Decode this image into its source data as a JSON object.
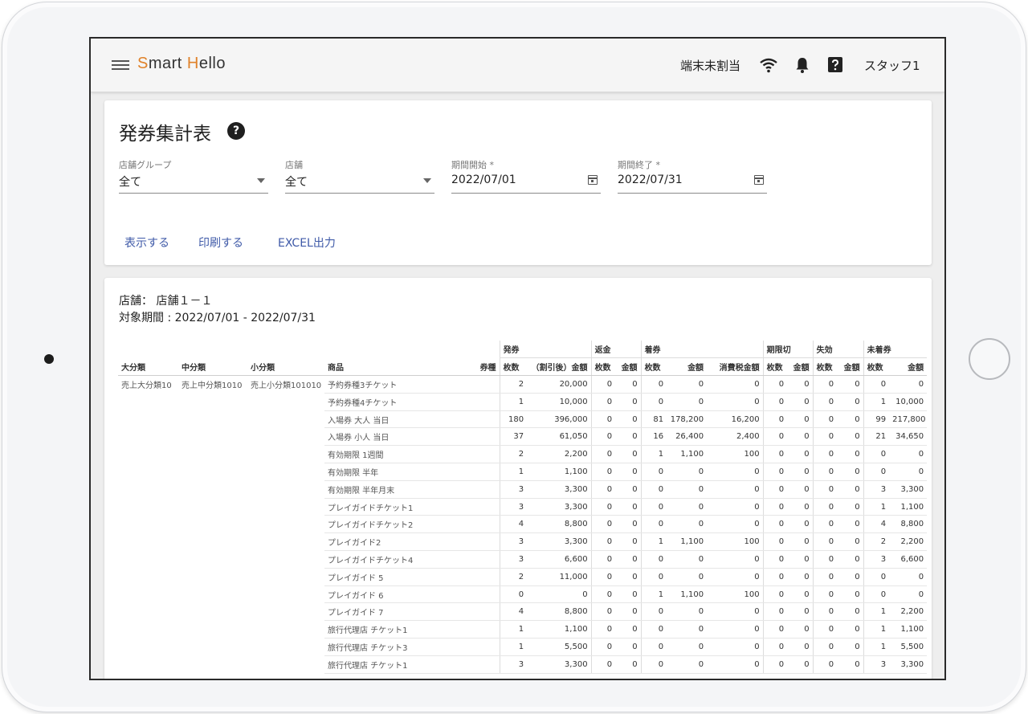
{
  "app": {
    "logo_first": "S",
    "logo_mid": "mart ",
    "logo_accent": "H",
    "logo_rest": "ello",
    "terminal": "端末未割当",
    "user": "スタッフ1",
    "accent_color": "#e0822a"
  },
  "icons": [
    "menu-icon",
    "wifi-icon",
    "bell-icon",
    "help-icon",
    "calendar-icon",
    "dropdown-icon"
  ],
  "page": {
    "title": "発券集計表",
    "filters": {
      "store_group": {
        "label": "店舗グループ",
        "value": "全て"
      },
      "store": {
        "label": "店舗",
        "value": "全て"
      },
      "start": {
        "label": "期間開始 *",
        "value": "2022/07/01"
      },
      "end": {
        "label": "期間終了 *",
        "value": "2022/07/31"
      }
    },
    "actions": {
      "show": "表示する",
      "print": "印刷する",
      "excel": "EXCEL出力"
    }
  },
  "report": {
    "store_line": "店舗： 店舗１－１",
    "period_line": "対象期間 : 2022/07/01 - 2022/07/31",
    "group_headers": [
      "発券",
      "返金",
      "着券",
      "期限切",
      "失効",
      "未着券"
    ],
    "columns": [
      "大分類",
      "中分類",
      "小分類",
      "商品",
      "券種",
      "枚数",
      "（割引後）金額",
      "枚数",
      "金額",
      "枚数",
      "金額",
      "消費税金額",
      "枚数",
      "金額",
      "枚数",
      "金額",
      "枚数",
      "金額"
    ],
    "category": {
      "large": "売上大分類10",
      "middle": "売上中分類1010",
      "small": "売上小分類101010"
    },
    "rows": [
      [
        "予約券種3チケット",
        "",
        "2",
        "20,000",
        "0",
        "0",
        "0",
        "0",
        "0",
        "0",
        "0",
        "0",
        "0",
        "0",
        "0"
      ],
      [
        "予約券種4チケット",
        "",
        "1",
        "10,000",
        "0",
        "0",
        "0",
        "0",
        "0",
        "0",
        "0",
        "0",
        "0",
        "1",
        "10,000"
      ],
      [
        "入場券 大人 当日",
        "",
        "180",
        "396,000",
        "0",
        "0",
        "81",
        "178,200",
        "16,200",
        "0",
        "0",
        "0",
        "0",
        "99",
        "217,800"
      ],
      [
        "入場券 小人 当日",
        "",
        "37",
        "61,050",
        "0",
        "0",
        "16",
        "26,400",
        "2,400",
        "0",
        "0",
        "0",
        "0",
        "21",
        "34,650"
      ],
      [
        "有効期限 1週間",
        "",
        "2",
        "2,200",
        "0",
        "0",
        "1",
        "1,100",
        "100",
        "0",
        "0",
        "0",
        "0",
        "0",
        "0"
      ],
      [
        "有効期限 半年",
        "",
        "1",
        "1,100",
        "0",
        "0",
        "0",
        "0",
        "0",
        "0",
        "0",
        "0",
        "0",
        "0",
        "0"
      ],
      [
        "有効期限 半年月末",
        "",
        "3",
        "3,300",
        "0",
        "0",
        "0",
        "0",
        "0",
        "0",
        "0",
        "0",
        "0",
        "3",
        "3,300"
      ],
      [
        "プレイガイドチケット1",
        "",
        "3",
        "3,300",
        "0",
        "0",
        "0",
        "0",
        "0",
        "0",
        "0",
        "0",
        "0",
        "1",
        "1,100"
      ],
      [
        "プレイガイドチケット2",
        "",
        "4",
        "8,800",
        "0",
        "0",
        "0",
        "0",
        "0",
        "0",
        "0",
        "0",
        "0",
        "4",
        "8,800"
      ],
      [
        "プレイガイド2",
        "",
        "3",
        "3,300",
        "0",
        "0",
        "1",
        "1,100",
        "100",
        "0",
        "0",
        "0",
        "0",
        "2",
        "2,200"
      ],
      [
        "プレイガイドチケット4",
        "",
        "3",
        "6,600",
        "0",
        "0",
        "0",
        "0",
        "0",
        "0",
        "0",
        "0",
        "0",
        "3",
        "6,600"
      ],
      [
        "プレイガイド 5",
        "",
        "2",
        "11,000",
        "0",
        "0",
        "0",
        "0",
        "0",
        "0",
        "0",
        "0",
        "0",
        "0",
        "0"
      ],
      [
        "プレイガイド 6",
        "",
        "0",
        "0",
        "0",
        "0",
        "1",
        "1,100",
        "100",
        "0",
        "0",
        "0",
        "0",
        "0",
        "0"
      ],
      [
        "プレイガイド 7",
        "",
        "4",
        "8,800",
        "0",
        "0",
        "0",
        "0",
        "0",
        "0",
        "0",
        "0",
        "0",
        "1",
        "2,200"
      ],
      [
        "旅行代理店 チケット1",
        "",
        "1",
        "1,100",
        "0",
        "0",
        "0",
        "0",
        "0",
        "0",
        "0",
        "0",
        "0",
        "1",
        "1,100"
      ],
      [
        "旅行代理店 チケット3",
        "",
        "1",
        "5,500",
        "0",
        "0",
        "0",
        "0",
        "0",
        "0",
        "0",
        "0",
        "0",
        "1",
        "5,500"
      ],
      [
        "旅行代理店 チケット1",
        "",
        "3",
        "3,300",
        "0",
        "0",
        "0",
        "0",
        "0",
        "0",
        "0",
        "0",
        "0",
        "3",
        "3,300"
      ]
    ]
  }
}
